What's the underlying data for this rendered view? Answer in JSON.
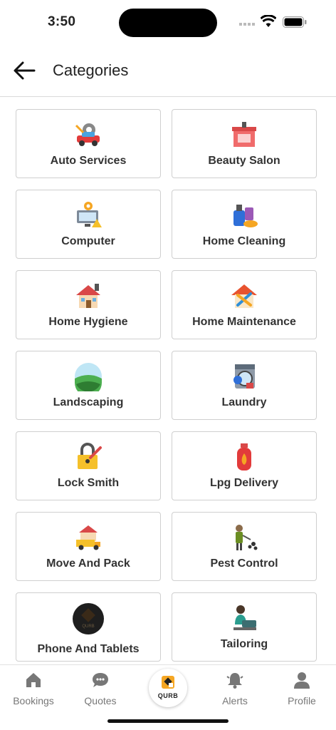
{
  "status_bar": {
    "time": "3:50"
  },
  "header": {
    "title": "Categories"
  },
  "categories": [
    {
      "label": "Auto Services",
      "icon": "auto-services-icon"
    },
    {
      "label": "Beauty Salon",
      "icon": "beauty-salon-icon"
    },
    {
      "label": "Computer",
      "icon": "computer-icon"
    },
    {
      "label": "Home Cleaning",
      "icon": "home-cleaning-icon"
    },
    {
      "label": "Home Hygiene",
      "icon": "home-hygiene-icon"
    },
    {
      "label": "Home Maintenance",
      "icon": "home-maintenance-icon"
    },
    {
      "label": "Landscaping",
      "icon": "landscaping-icon"
    },
    {
      "label": "Laundry",
      "icon": "laundry-icon"
    },
    {
      "label": "Lock Smith",
      "icon": "lock-smith-icon"
    },
    {
      "label": "Lpg Delivery",
      "icon": "lpg-delivery-icon"
    },
    {
      "label": "Move And Pack",
      "icon": "move-and-pack-icon"
    },
    {
      "label": "Pest Control",
      "icon": "pest-control-icon"
    },
    {
      "label": "Phone And Tablets",
      "icon": "qurb-logo-icon"
    },
    {
      "label": "Tailoring",
      "icon": "tailoring-icon"
    }
  ],
  "bottom_nav": {
    "bookings": "Bookings",
    "quotes": "Quotes",
    "center_logo": "QURB",
    "alerts": "Alerts",
    "profile": "Profile"
  },
  "colors": {
    "logo_orange": "#f5a623",
    "tab_gray": "#777777",
    "card_border": "#cfcfcf"
  }
}
